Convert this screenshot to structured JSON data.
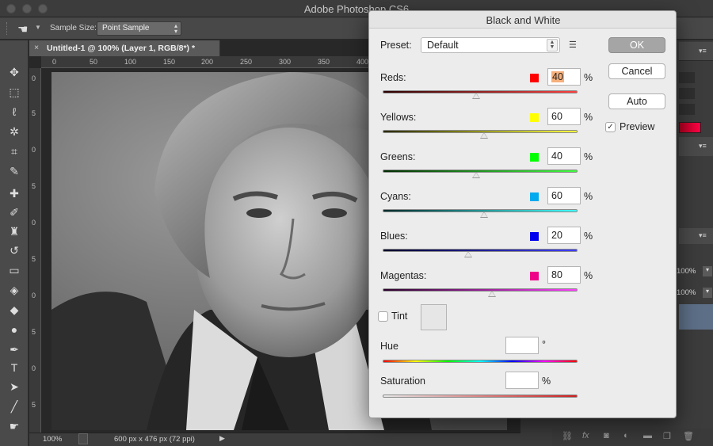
{
  "app": {
    "title": "Adobe Photoshop CS6"
  },
  "options_bar": {
    "sample_size_label": "Sample Size:",
    "sample_size_value": "Point Sample"
  },
  "document": {
    "tab_title": "Untitled-1 @ 100% (Layer 1, RGB/8*) *",
    "close_glyph": "×",
    "ruler_h": [
      "0",
      "50",
      "100",
      "150",
      "200",
      "250",
      "300",
      "350",
      "400"
    ],
    "ruler_v": [
      "0",
      "5",
      "0",
      "5",
      "0",
      "5",
      "0",
      "5",
      "0",
      "5",
      "0"
    ],
    "zoom": "100%",
    "doc_info": "600 px x 476 px (72 ppi)"
  },
  "right_panel": {
    "zoom1": "100%",
    "zoom2": "100%"
  },
  "dialog": {
    "title": "Black and White",
    "preset_label": "Preset:",
    "preset_value": "Default",
    "ok_label": "OK",
    "cancel_label": "Cancel",
    "auto_label": "Auto",
    "preview_label": "Preview",
    "preview_checked": true,
    "pct_symbol": "%",
    "channels": [
      {
        "name": "Reds:",
        "value": "40",
        "color": "#ff0000",
        "slider_fraction": 0.48
      },
      {
        "name": "Yellows:",
        "value": "60",
        "color": "#ffff00",
        "slider_fraction": 0.52
      },
      {
        "name": "Greens:",
        "value": "40",
        "color": "#00ff00",
        "slider_fraction": 0.48
      },
      {
        "name": "Cyans:",
        "value": "60",
        "color": "#00aaee",
        "slider_fraction": 0.52
      },
      {
        "name": "Blues:",
        "value": "20",
        "color": "#0000ee",
        "slider_fraction": 0.44
      },
      {
        "name": "Magentas:",
        "value": "80",
        "color": "#ee0088",
        "slider_fraction": 0.56
      }
    ],
    "tint_label": "Tint",
    "tint_checked": false,
    "hue_label": "Hue",
    "hue_unit": "°",
    "hue_value": "",
    "saturation_label": "Saturation",
    "saturation_unit": "%",
    "saturation_value": ""
  }
}
